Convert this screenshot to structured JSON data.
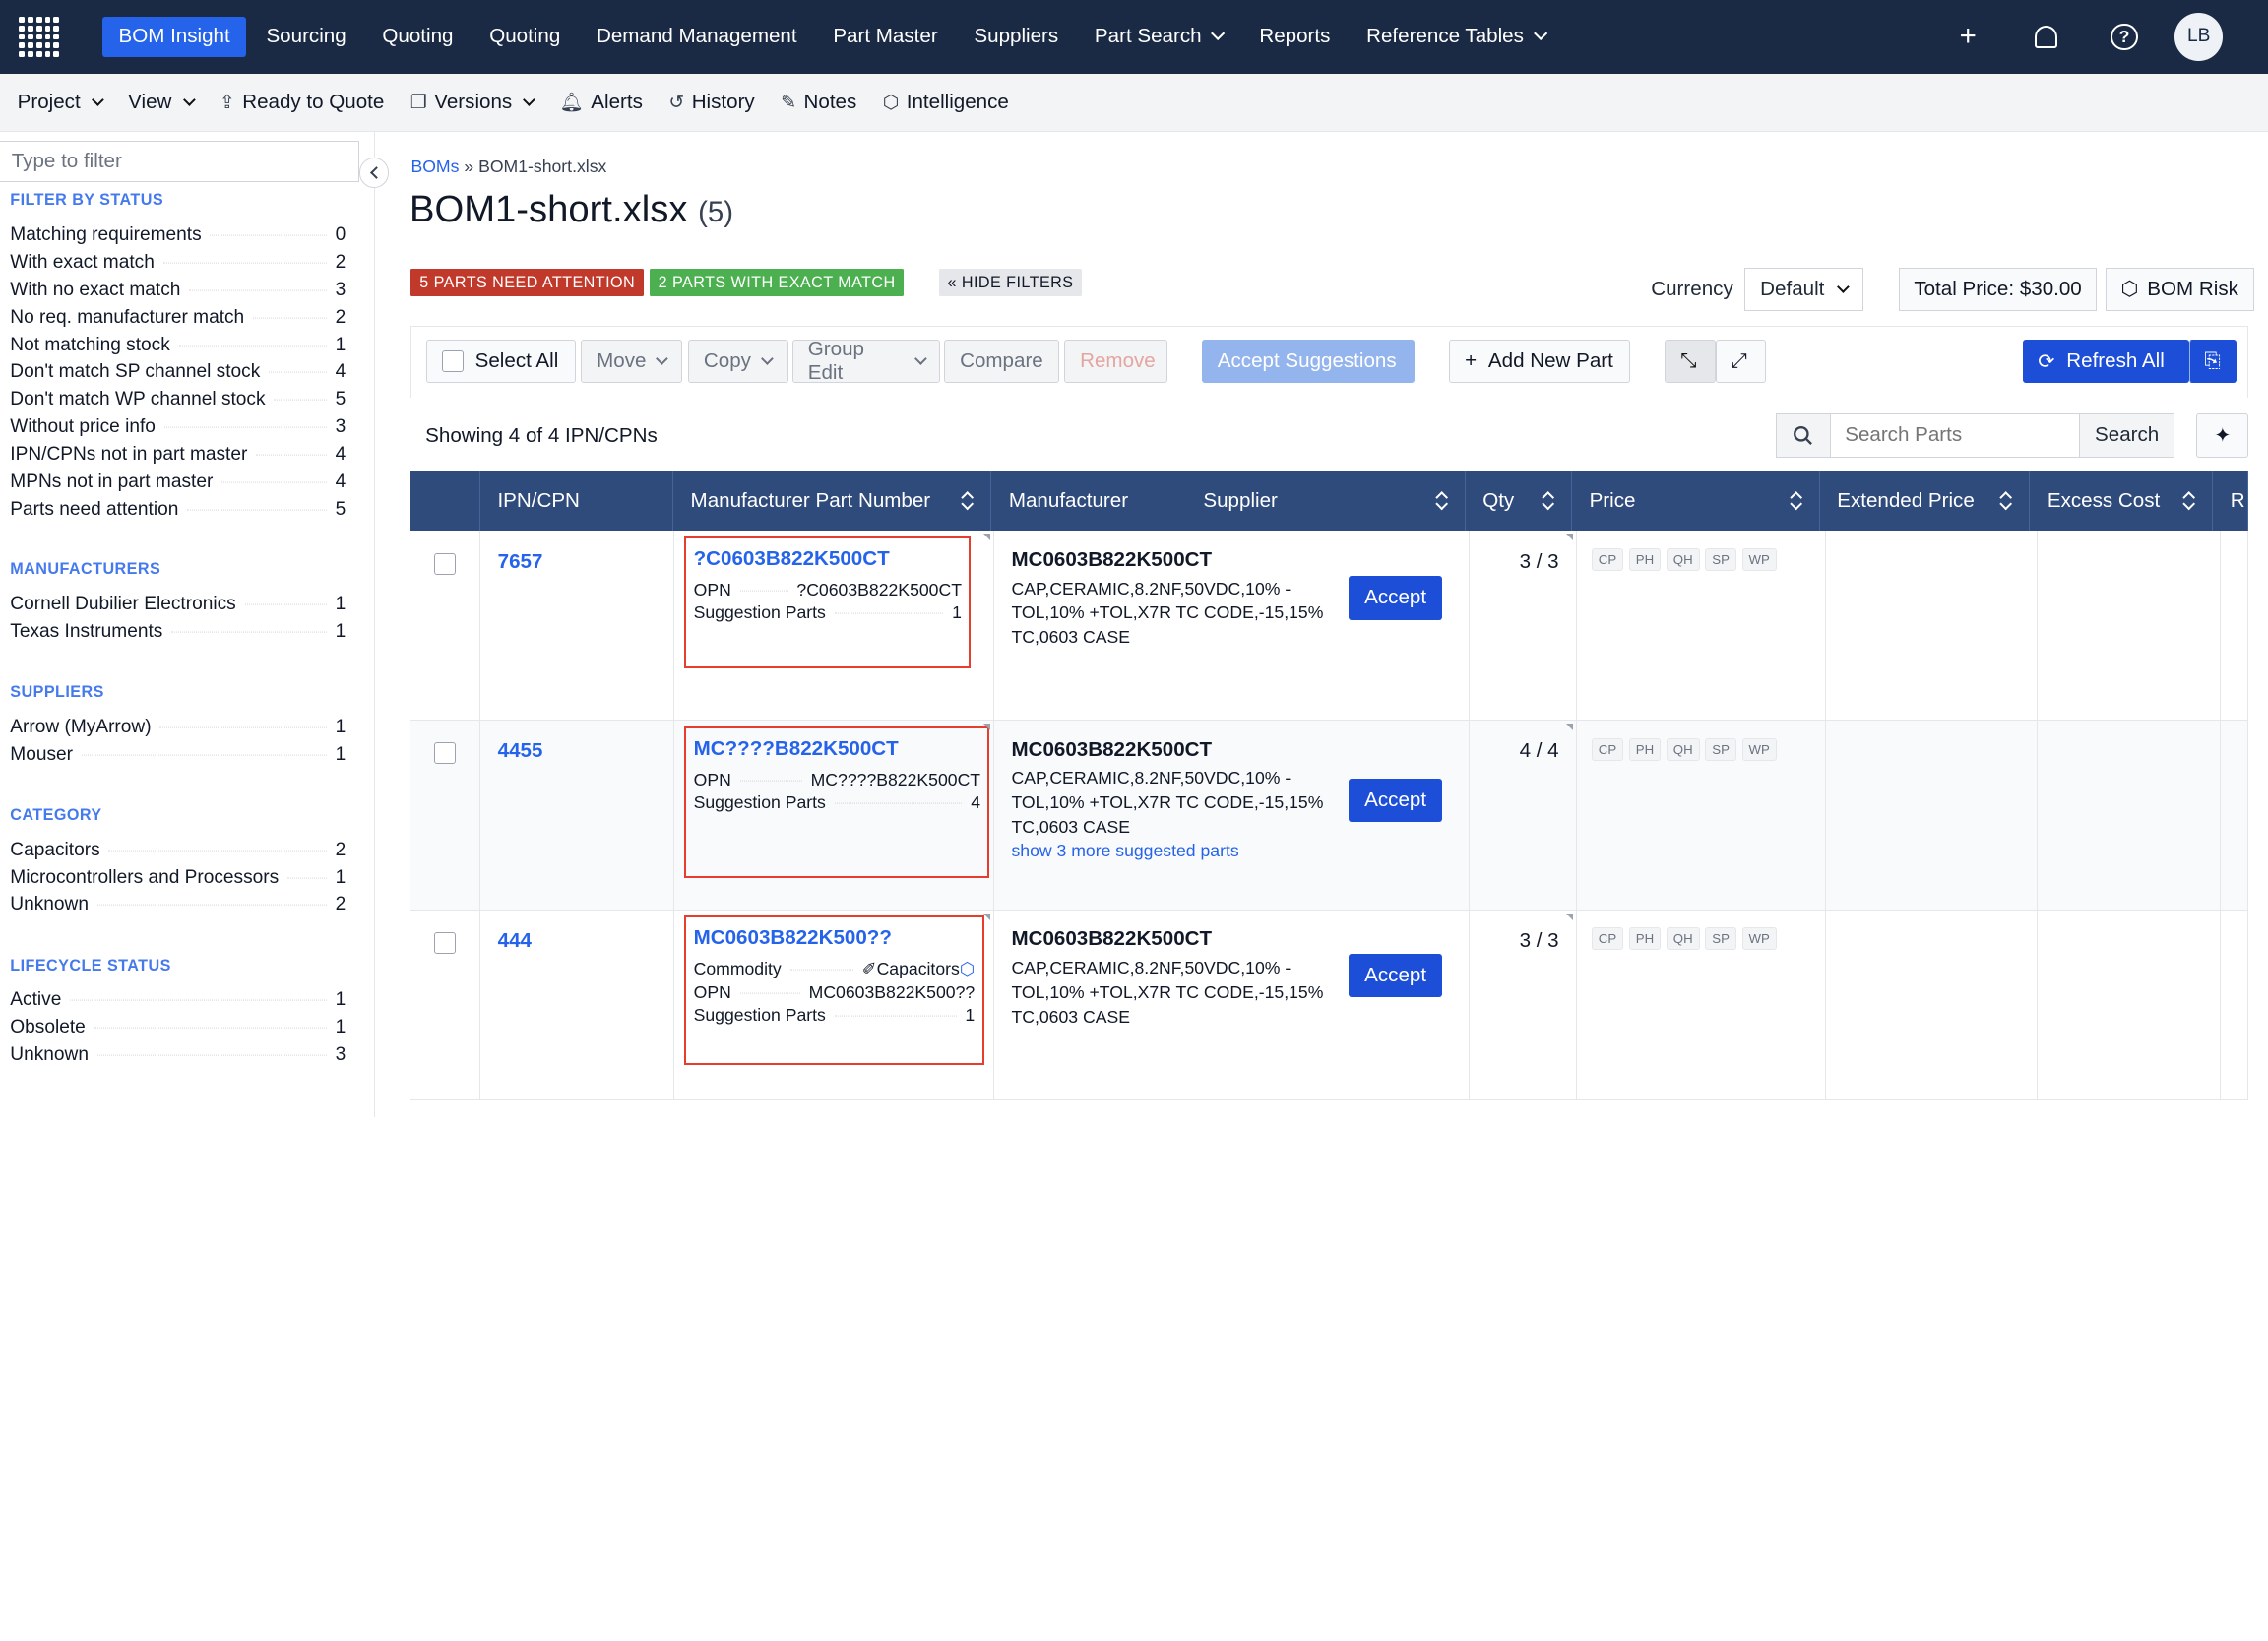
{
  "topnav": {
    "items": [
      {
        "label": "BOM Insight",
        "active": true,
        "dropdown": false
      },
      {
        "label": "Sourcing",
        "dropdown": false
      },
      {
        "label": "Quoting",
        "dropdown": false
      },
      {
        "label": "Quoting",
        "dropdown": false
      },
      {
        "label": "Demand Management",
        "dropdown": false
      },
      {
        "label": "Part Master",
        "dropdown": false
      },
      {
        "label": "Suppliers",
        "dropdown": false
      },
      {
        "label": "Part Search",
        "dropdown": true
      },
      {
        "label": "Reports",
        "dropdown": false
      },
      {
        "label": "Reference Tables",
        "dropdown": true
      }
    ],
    "avatar": "LB",
    "accent": "#2563eb",
    "background": "#1b2a44"
  },
  "subbar": {
    "project": "Project",
    "view": "View",
    "ready_to_quote": "Ready to Quote",
    "versions": "Versions",
    "alerts": "Alerts",
    "history": "History",
    "notes": "Notes",
    "intelligence": "Intelligence"
  },
  "sidebar": {
    "filter_placeholder": "Type to filter",
    "sections": [
      {
        "heading": "FILTER BY STATUS",
        "rows": [
          {
            "label": "Matching requirements",
            "count": "0"
          },
          {
            "label": "With exact match",
            "count": "2"
          },
          {
            "label": "With no exact match",
            "count": "3"
          },
          {
            "label": "No req. manufacturer match",
            "count": "2"
          },
          {
            "label": "Not matching stock",
            "count": "1"
          },
          {
            "label": "Don't match SP channel stock",
            "count": "4"
          },
          {
            "label": "Don't match WP channel stock",
            "count": "5"
          },
          {
            "label": "Without price info",
            "count": "3"
          },
          {
            "label": "IPN/CPNs not in part master",
            "count": "4"
          },
          {
            "label": "MPNs not in part master",
            "count": "4"
          },
          {
            "label": "Parts need attention",
            "count": "5"
          }
        ]
      },
      {
        "heading": "MANUFACTURERS",
        "rows": [
          {
            "label": "Cornell Dubilier Electronics",
            "count": "1"
          },
          {
            "label": "Texas Instruments",
            "count": "1"
          }
        ]
      },
      {
        "heading": "SUPPLIERS",
        "rows": [
          {
            "label": "Arrow (MyArrow)",
            "count": "1"
          },
          {
            "label": "Mouser",
            "count": "1"
          }
        ]
      },
      {
        "heading": "CATEGORY",
        "rows": [
          {
            "label": "Capacitors",
            "count": "2"
          },
          {
            "label": "Microcontrollers and Processors",
            "count": "1"
          },
          {
            "label": "Unknown",
            "count": "2"
          }
        ]
      },
      {
        "heading": "LIFECYCLE STATUS",
        "rows": [
          {
            "label": "Active",
            "count": "1"
          },
          {
            "label": "Obsolete",
            "count": "1"
          },
          {
            "label": "Unknown",
            "count": "3"
          }
        ]
      }
    ]
  },
  "main": {
    "breadcrumb_root": "BOMs",
    "breadcrumb_sep": "»",
    "breadcrumb_current": "BOM1-short.xlsx",
    "title": "BOM1-short.xlsx",
    "title_count": "(5)",
    "badge_attention": "5 PARTS NEED ATTENTION",
    "badge_exact": "2 PARTS WITH EXACT MATCH",
    "hide_filters": "« HIDE FILTERS",
    "currency_label": "Currency",
    "currency_value": "Default",
    "total_price": "Total Price: $30.00",
    "bom_risk": "BOM Risk",
    "select_all": "Select All",
    "move": "Move",
    "copy": "Copy",
    "group_edit": "Group Edit",
    "compare": "Compare",
    "remove": "Remove",
    "accept_suggestions": "Accept Suggestions",
    "add_new_part": "Add New Part",
    "refresh_all": "Refresh All",
    "showing": "Showing 4 of 4 IPN/CPNs",
    "search_placeholder": "Search Parts",
    "search_button": "Search",
    "danger_color": "#e53e2f"
  },
  "table": {
    "headers": [
      "IPN/CPN",
      "Manufacturer Part Number",
      "Manufacturer",
      "Supplier",
      "Qty",
      "Price",
      "Extended Price",
      "Excess Cost",
      "R"
    ],
    "chips": [
      "CP",
      "PH",
      "QH",
      "SP",
      "WP"
    ],
    "accept_label": "Accept",
    "rows": [
      {
        "ipn": "7657",
        "mpn": "?C0603B822K500CT",
        "commodity_label": "",
        "commodity_value": "",
        "opn_label": "OPN",
        "opn_value": "?C0603B822K500CT",
        "sugg_label": "Suggestion Parts",
        "sugg_value": "1",
        "mfr_name": "MC0603B822K500CT",
        "desc": "CAP,CERAMIC,8.2NF,50VDC,10% -TOL,10% +TOL,X7R TC CODE,-15,15% TC,0603 CASE",
        "more": "",
        "qty": "3 / 3"
      },
      {
        "ipn": "4455",
        "mpn": "MC????B822K500CT",
        "commodity_label": "",
        "commodity_value": "",
        "opn_label": "OPN",
        "opn_value": "MC????B822K500CT",
        "sugg_label": "Suggestion Parts",
        "sugg_value": "4",
        "mfr_name": "MC0603B822K500CT",
        "desc": "CAP,CERAMIC,8.2NF,50VDC,10% -TOL,10% +TOL,X7R TC CODE,-15,15% TC,0603 CASE",
        "more": "show 3 more suggested parts",
        "qty": "4 / 4"
      },
      {
        "ipn": "444",
        "mpn": "MC0603B822K500??",
        "commodity_label": "Commodity",
        "commodity_value": "Capacitors",
        "opn_label": "OPN",
        "opn_value": "MC0603B822K500??",
        "sugg_label": "Suggestion Parts",
        "sugg_value": "1",
        "mfr_name": "MC0603B822K500CT",
        "desc": "CAP,CERAMIC,8.2NF,50VDC,10% -TOL,10% +TOL,X7R TC CODE,-15,15% TC,0603 CASE",
        "more": "",
        "qty": "3 / 3"
      }
    ]
  }
}
